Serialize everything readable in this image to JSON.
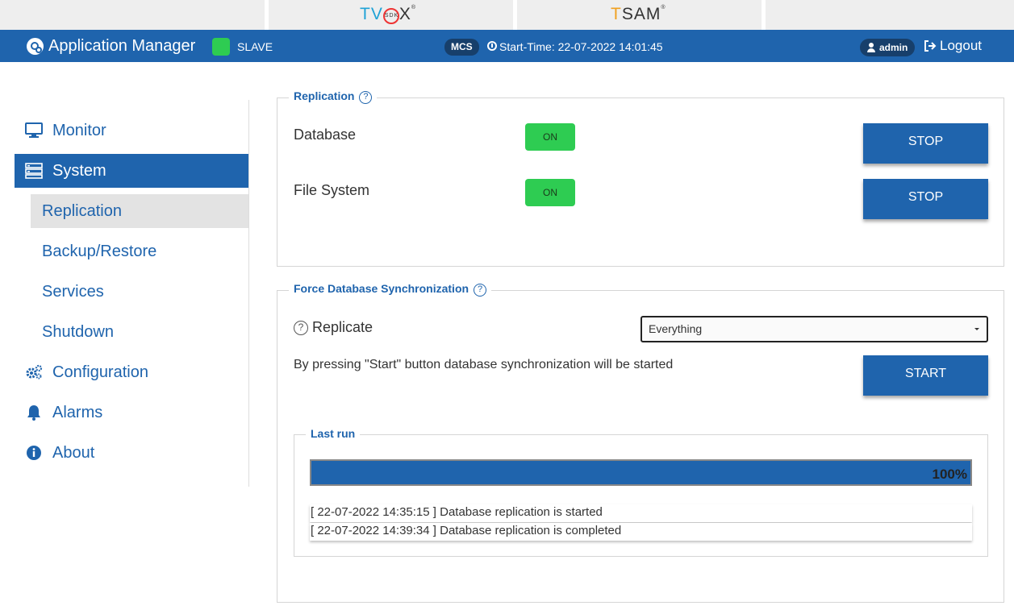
{
  "brands": {
    "tvox_prefix": "TV",
    "tvox_suffix": "X",
    "tvox_badge": "SDK",
    "tsam_prefix": "T",
    "tsam_suffix": "SAM"
  },
  "header": {
    "app_title": "Application Manager",
    "role": "SLAVE",
    "role_color": "#2ecc52",
    "node_badge": "MCS",
    "start_time": "Start-Time: 22-07-2022 14:01:45",
    "user": "admin",
    "logout": "Logout",
    "bar_color": "#1f64ad"
  },
  "sidebar": {
    "items": [
      {
        "label": "Monitor",
        "icon": "monitor-icon"
      },
      {
        "label": "System",
        "icon": "server-icon"
      },
      {
        "label": "Configuration",
        "icon": "gears-icon"
      },
      {
        "label": "Alarms",
        "icon": "bell-icon"
      },
      {
        "label": "About",
        "icon": "info-icon"
      }
    ],
    "sub_items": [
      {
        "label": "Replication"
      },
      {
        "label": "Backup/Restore"
      },
      {
        "label": "Services"
      },
      {
        "label": "Shutdown"
      }
    ]
  },
  "replication": {
    "legend": "Replication",
    "rows": [
      {
        "label": "Database",
        "state": "ON",
        "action": "STOP"
      },
      {
        "label": "File System",
        "state": "ON",
        "action": "STOP"
      }
    ]
  },
  "force_sync": {
    "legend": "Force Database Synchronization",
    "replicate_label": "Replicate",
    "replicate_value": "Everything",
    "info": "By pressing \"Start\" button database synchronization will be started",
    "start_label": "START"
  },
  "last_run": {
    "legend": "Last run",
    "progress_percent": 100,
    "progress_label": "100%",
    "log": [
      "[ 22-07-2022 14:35:15 ] Database replication is started",
      "[ 22-07-2022 14:39:34 ] Database replication is completed"
    ]
  }
}
